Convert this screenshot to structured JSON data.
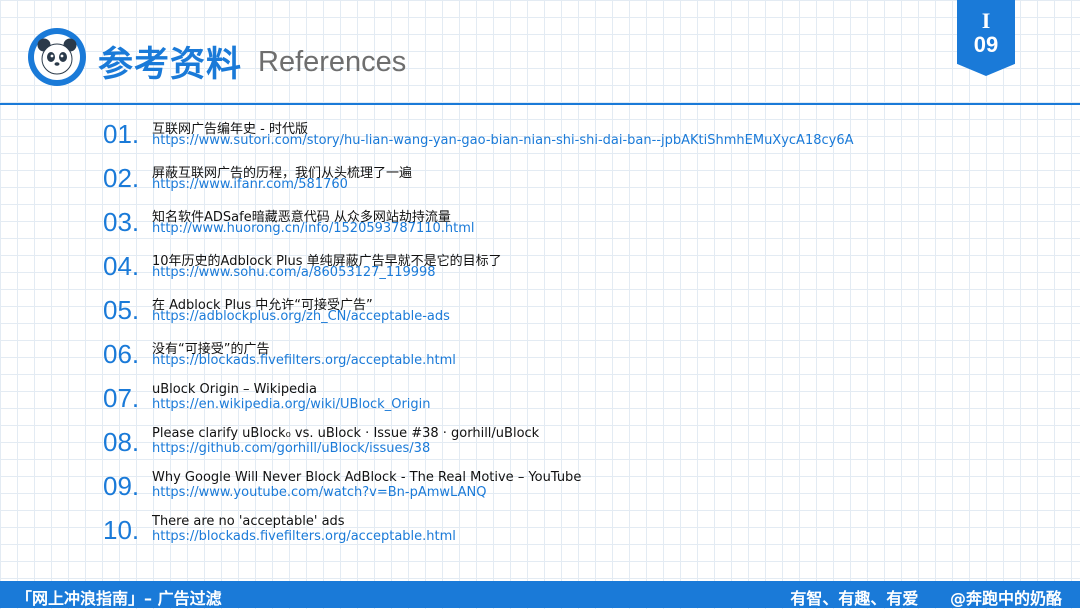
{
  "header": {
    "title_cn": "参考资料",
    "title_en": "References",
    "logo_icon": "panda-logo-icon"
  },
  "badge": {
    "roman": "I",
    "page": "09"
  },
  "references": [
    {
      "number": "01.",
      "title": "互联网广告编年史 - 时代版",
      "url": "https://www.sutori.com/story/hu-lian-wang-yan-gao-bian-nian-shi-shi-dai-ban--jpbAKtiShmhEMuXycA18cy6A"
    },
    {
      "number": "02.",
      "title": "屏蔽互联网广告的历程，我们从头梳理了一遍",
      "url": "https://www.ifanr.com/581760"
    },
    {
      "number": "03.",
      "title": "知名软件ADSafe暗藏恶意代码 从众多网站劫持流量",
      "url": "http://www.huorong.cn/info/1520593787110.html"
    },
    {
      "number": "04.",
      "title": "10年历史的Adblock Plus 单纯屏蔽广告早就不是它的目标了",
      "url": "https://www.sohu.com/a/86053127_119998"
    },
    {
      "number": "05.",
      "title": "在 Adblock Plus 中允许“可接受广告”",
      "url": "https://adblockplus.org/zh_CN/acceptable-ads"
    },
    {
      "number": "06.",
      "title": "没有“可接受”的广告",
      "url": "https://blockads.fivefilters.org/acceptable.html"
    },
    {
      "number": "07.",
      "title": "uBlock Origin – Wikipedia",
      "url": "https://en.wikipedia.org/wiki/UBlock_Origin"
    },
    {
      "number": "08.",
      "title": "Please clarify uBlock₀ vs. uBlock · Issue #38 · gorhill/uBlock",
      "url": "https://github.com/gorhill/uBlock/issues/38"
    },
    {
      "number": "09.",
      "title": "Why Google Will Never Block AdBlock - The Real Motive – YouTube",
      "url": "https://www.youtube.com/watch?v=Bn-pAmwLANQ"
    },
    {
      "number": "10.",
      "title": "There are no 'acceptable' ads",
      "url": "https://blockads.fivefilters.org/acceptable.html"
    }
  ],
  "footer": {
    "left": "「网上冲浪指南」– 广告过滤",
    "right": "有智、有趣、有爱",
    "author": "@奔跑中的奶酪"
  },
  "colors": {
    "accent": "#1a7ad8",
    "grid": "#e3ebf3",
    "text": "#111111",
    "subtitle": "#6e6e6e"
  }
}
